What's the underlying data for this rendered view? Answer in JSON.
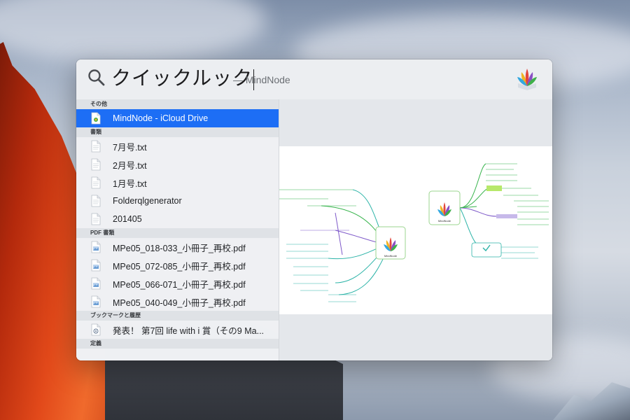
{
  "search": {
    "query": "クイックルック",
    "suffix": "— MindNode",
    "app_icon": "mindnode-app-icon"
  },
  "sections": [
    {
      "title": "その他",
      "items": [
        {
          "label": "MindNode   - iCloud Drive",
          "icon": "mindnode-document-icon",
          "selected": true
        }
      ]
    },
    {
      "title": "書類",
      "items": [
        {
          "label": "7月号.txt",
          "icon": "text-document-icon"
        },
        {
          "label": "2月号.txt",
          "icon": "text-document-icon"
        },
        {
          "label": "1月号.txt",
          "icon": "text-document-icon"
        },
        {
          "label": "Folderqlgenerator",
          "icon": "text-document-icon"
        },
        {
          "label": "201405",
          "icon": "text-document-icon"
        }
      ]
    },
    {
      "title": "PDF 書類",
      "items": [
        {
          "label": "MPe05_018-033_小冊子_再校.pdf",
          "icon": "pdf-document-icon"
        },
        {
          "label": "MPe05_072-085_小冊子_再校.pdf",
          "icon": "pdf-document-icon"
        },
        {
          "label": "MPe05_066-071_小冊子_再校.pdf",
          "icon": "pdf-document-icon"
        },
        {
          "label": "MPe05_040-049_小冊子_再校.pdf",
          "icon": "pdf-document-icon"
        }
      ]
    },
    {
      "title": "ブックマークと履歴",
      "items": [
        {
          "label": "発表！ 第7回 life with i 賞（その9 Ma...",
          "icon": "bookmark-icon"
        }
      ]
    },
    {
      "title": "定義",
      "items": []
    }
  ],
  "preview": {
    "node_left": "MindNode",
    "node_right": "MindNode"
  },
  "colors": {
    "selection": "#1d6ef5",
    "branch_teal": "#2bb3a7",
    "branch_green": "#35b34a",
    "branch_purple": "#7e59c9"
  }
}
